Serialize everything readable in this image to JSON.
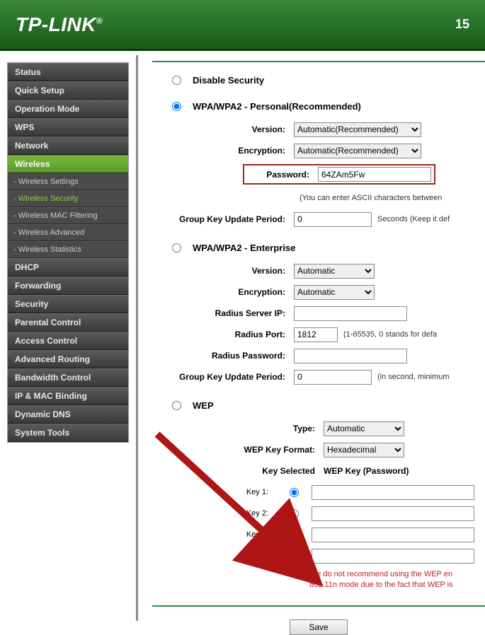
{
  "header": {
    "logo": "TP-LINK",
    "model": "15"
  },
  "sidebar": {
    "items": [
      {
        "label": "Status"
      },
      {
        "label": "Quick Setup"
      },
      {
        "label": "Operation Mode"
      },
      {
        "label": "WPS"
      },
      {
        "label": "Network"
      },
      {
        "label": "Wireless",
        "active": true
      },
      {
        "label": "DHCP"
      },
      {
        "label": "Forwarding"
      },
      {
        "label": "Security"
      },
      {
        "label": "Parental Control"
      },
      {
        "label": "Access Control"
      },
      {
        "label": "Advanced Routing"
      },
      {
        "label": "Bandwidth Control"
      },
      {
        "label": "IP & MAC Binding"
      },
      {
        "label": "Dynamic DNS"
      },
      {
        "label": "System Tools"
      }
    ],
    "subs": [
      {
        "label": "- Wireless Settings"
      },
      {
        "label": "- Wireless Security",
        "active": true
      },
      {
        "label": "- Wireless MAC Filtering"
      },
      {
        "label": "- Wireless Advanced"
      },
      {
        "label": "- Wireless Statistics"
      }
    ]
  },
  "security": {
    "disable_label": "Disable Security",
    "wpa_personal": {
      "title": "WPA/WPA2 - Personal(Recommended)",
      "version_label": "Version:",
      "version_value": "Automatic(Recommended)",
      "encryption_label": "Encryption:",
      "encryption_value": "Automatic(Recommended)",
      "password_label": "Password:",
      "password_value": "64ZAm5Fw",
      "password_hint": "(You can enter ASCII characters between",
      "gkup_label": "Group Key Update Period:",
      "gkup_value": "0",
      "gkup_hint": "Seconds (Keep it def"
    },
    "wpa_ent": {
      "title": "WPA/WPA2 - Enterprise",
      "version_label": "Version:",
      "version_value": "Automatic",
      "encryption_label": "Encryption:",
      "encryption_value": "Automatic",
      "radius_ip_label": "Radius Server IP:",
      "radius_ip_value": "",
      "radius_port_label": "Radius Port:",
      "radius_port_value": "1812",
      "radius_port_hint": "(1-65535, 0 stands for defa",
      "radius_pw_label": "Radius Password:",
      "radius_pw_value": "",
      "gkup_label": "Group Key Update Period:",
      "gkup_value": "0",
      "gkup_hint": "(in second, minimum"
    },
    "wep": {
      "title": "WEP",
      "type_label": "Type:",
      "type_value": "Automatic",
      "format_label": "WEP Key Format:",
      "format_value": "Hexadecimal",
      "key_selected": "Key Selected",
      "wep_key_header": "WEP Key (Password)",
      "keys": [
        {
          "label": "Key 1:"
        },
        {
          "label": "Key 2:"
        },
        {
          "label": "Key 3:"
        },
        {
          "label": "Key 4:"
        }
      ],
      "warning": "We do not recommend using the WEP en\n802.11n mode due to the fact that WEP is"
    },
    "save": "Save"
  }
}
